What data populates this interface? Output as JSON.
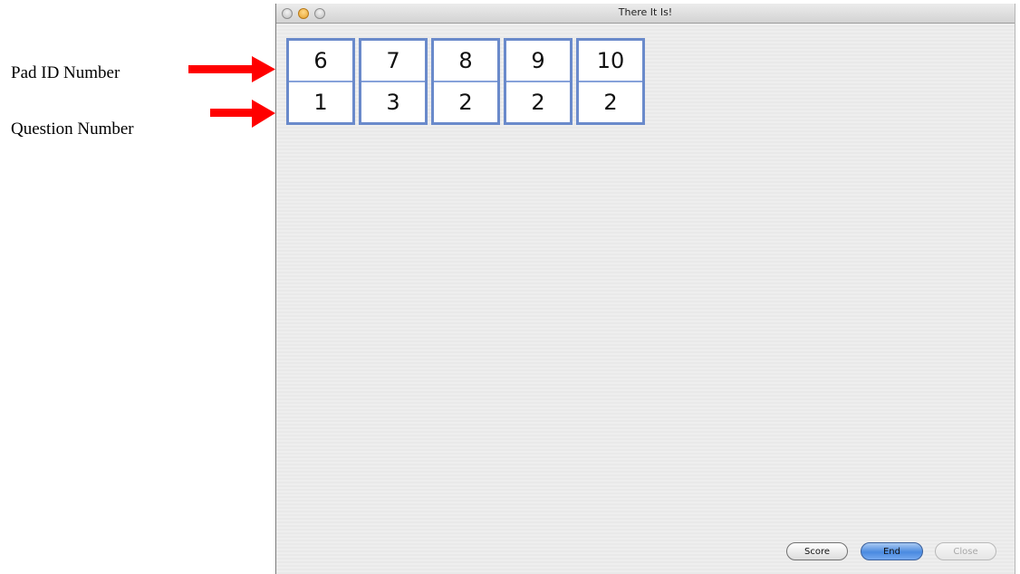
{
  "annotations": {
    "pad_id_label": "Pad ID Number",
    "question_label": "Question Number",
    "arrow_color": "#ff0000"
  },
  "window": {
    "title": "There It Is!"
  },
  "pads": [
    {
      "pad_id": "6",
      "question": "1"
    },
    {
      "pad_id": "7",
      "question": "3"
    },
    {
      "pad_id": "8",
      "question": "2"
    },
    {
      "pad_id": "9",
      "question": "2"
    },
    {
      "pad_id": "10",
      "question": "2"
    }
  ],
  "buttons": {
    "score": "Score",
    "end": "End",
    "close": "Close"
  },
  "colors": {
    "pad_border": "#6a8acb",
    "default_button": "#4a8ae0"
  }
}
